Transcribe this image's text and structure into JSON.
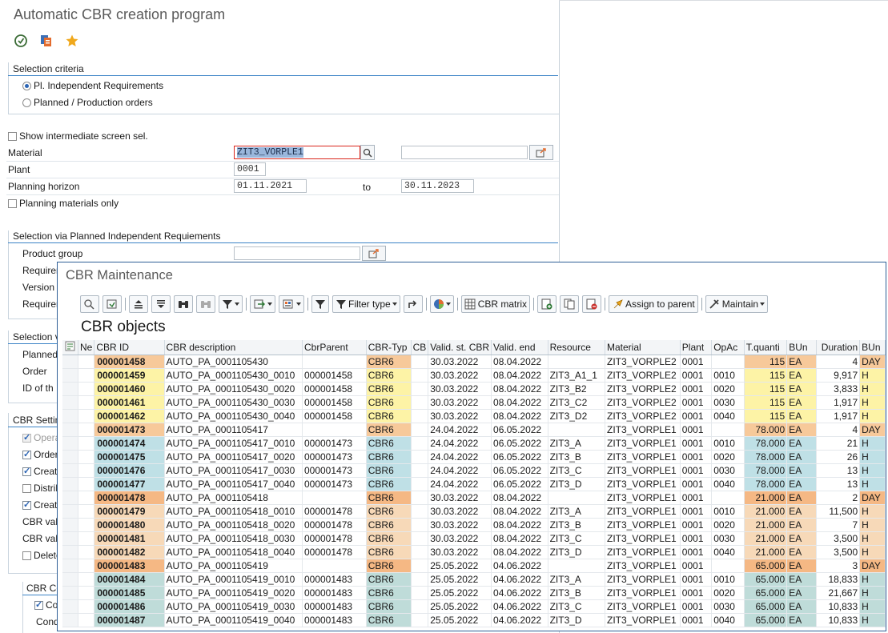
{
  "back": {
    "title": "Automatic CBR creation program",
    "sel_criteria": {
      "header": "Selection criteria",
      "opt1": "Pl. Independent Requirements",
      "opt2": "Planned / Production orders"
    },
    "show_inter": "Show intermediate screen sel.",
    "material": {
      "label": "Material",
      "value": "ZIT3_VORPLE1"
    },
    "plant": {
      "label": "Plant",
      "value": "0001"
    },
    "horizon": {
      "label": "Planning horizon",
      "from": "01.11.2021",
      "to_label": "to",
      "to": "30.11.2023"
    },
    "plan_only": "Planning materials only",
    "sel_pir": {
      "header": "Selection via Planned Independent Requiements",
      "product_group": "Product group",
      "labels": [
        "Requirem",
        "Version",
        "Requirem"
      ]
    },
    "sel_v": {
      "header": "Selection v",
      "labels": [
        "Planned",
        "Order",
        "ID of th"
      ]
    },
    "cbr_settings": {
      "header": "CBR Settin",
      "checks": [
        "Opera",
        "Order",
        "Creat",
        "Distrib",
        "Creat"
      ],
      "checks_on": [
        true,
        true,
        true,
        false,
        true
      ],
      "labels": [
        "CBR val",
        "CBR val"
      ],
      "delete": "Delete"
    },
    "cbr_co": {
      "header": "CBR Co",
      "check": "Co",
      "cond": "Cond"
    }
  },
  "front": {
    "title": "CBR Maintenance",
    "toolbar": {
      "filter_type": "Filter type",
      "cbr_matrix": "CBR matrix",
      "assign_parent": "Assign to parent",
      "maintain": "Maintain"
    },
    "section_title": "CBR objects",
    "columns": [
      "Ne",
      "CBR ID",
      "CBR description",
      "CbrParent",
      "CBR-Typ",
      "CB",
      "Valid. st. CBR",
      "Valid. end",
      "Resource",
      "Material",
      "Plant",
      "OpAc",
      "T.quanti",
      "BUn",
      "Duration",
      "BUn"
    ],
    "rows": [
      [
        "000001458",
        "AUTO_PA_0001105430",
        "",
        "CBR6",
        "30.03.2022",
        "08.04.2022",
        "",
        "ZIT3_VORPLE2",
        "0001",
        "",
        "115",
        "EA",
        "4",
        "DAY"
      ],
      [
        "000001459",
        "AUTO_PA_0001105430_0010",
        "000001458",
        "CBR6",
        "30.03.2022",
        "08.04.2022",
        "ZIT3_A1_1",
        "ZIT3_VORPLE2",
        "0001",
        "0010",
        "115",
        "EA",
        "9,917",
        "H"
      ],
      [
        "000001460",
        "AUTO_PA_0001105430_0020",
        "000001458",
        "CBR6",
        "30.03.2022",
        "08.04.2022",
        "ZIT3_B2",
        "ZIT3_VORPLE2",
        "0001",
        "0020",
        "115",
        "EA",
        "3,833",
        "H"
      ],
      [
        "000001461",
        "AUTO_PA_0001105430_0030",
        "000001458",
        "CBR6",
        "30.03.2022",
        "08.04.2022",
        "ZIT3_C2",
        "ZIT3_VORPLE2",
        "0001",
        "0030",
        "115",
        "EA",
        "1,917",
        "H"
      ],
      [
        "000001462",
        "AUTO_PA_0001105430_0040",
        "000001458",
        "CBR6",
        "30.03.2022",
        "08.04.2022",
        "ZIT3_D2",
        "ZIT3_VORPLE2",
        "0001",
        "0040",
        "115",
        "EA",
        "1,917",
        "H"
      ],
      [
        "000001473",
        "AUTO_PA_0001105417",
        "",
        "CBR6",
        "24.04.2022",
        "06.05.2022",
        "",
        "ZIT3_VORPLE1",
        "0001",
        "",
        "78.000",
        "EA",
        "4",
        "DAY"
      ],
      [
        "000001474",
        "AUTO_PA_0001105417_0010",
        "000001473",
        "CBR6",
        "24.04.2022",
        "06.05.2022",
        "ZIT3_A",
        "ZIT3_VORPLE1",
        "0001",
        "0010",
        "78.000",
        "EA",
        "21",
        "H"
      ],
      [
        "000001475",
        "AUTO_PA_0001105417_0020",
        "000001473",
        "CBR6",
        "24.04.2022",
        "06.05.2022",
        "ZIT3_B",
        "ZIT3_VORPLE1",
        "0001",
        "0020",
        "78.000",
        "EA",
        "26",
        "H"
      ],
      [
        "000001476",
        "AUTO_PA_0001105417_0030",
        "000001473",
        "CBR6",
        "24.04.2022",
        "06.05.2022",
        "ZIT3_C",
        "ZIT3_VORPLE1",
        "0001",
        "0030",
        "78.000",
        "EA",
        "13",
        "H"
      ],
      [
        "000001477",
        "AUTO_PA_0001105417_0040",
        "000001473",
        "CBR6",
        "24.04.2022",
        "06.05.2022",
        "ZIT3_D",
        "ZIT3_VORPLE1",
        "0001",
        "0040",
        "78.000",
        "EA",
        "13",
        "H"
      ],
      [
        "000001478",
        "AUTO_PA_0001105418",
        "",
        "CBR6",
        "30.03.2022",
        "08.04.2022",
        "",
        "ZIT3_VORPLE1",
        "0001",
        "",
        "21.000",
        "EA",
        "2",
        "DAY"
      ],
      [
        "000001479",
        "AUTO_PA_0001105418_0010",
        "000001478",
        "CBR6",
        "30.03.2022",
        "08.04.2022",
        "ZIT3_A",
        "ZIT3_VORPLE1",
        "0001",
        "0010",
        "21.000",
        "EA",
        "11,500",
        "H"
      ],
      [
        "000001480",
        "AUTO_PA_0001105418_0020",
        "000001478",
        "CBR6",
        "30.03.2022",
        "08.04.2022",
        "ZIT3_B",
        "ZIT3_VORPLE1",
        "0001",
        "0020",
        "21.000",
        "EA",
        "7",
        "H"
      ],
      [
        "000001481",
        "AUTO_PA_0001105418_0030",
        "000001478",
        "CBR6",
        "30.03.2022",
        "08.04.2022",
        "ZIT3_C",
        "ZIT3_VORPLE1",
        "0001",
        "0030",
        "21.000",
        "EA",
        "3,500",
        "H"
      ],
      [
        "000001482",
        "AUTO_PA_0001105418_0040",
        "000001478",
        "CBR6",
        "30.03.2022",
        "08.04.2022",
        "ZIT3_D",
        "ZIT3_VORPLE1",
        "0001",
        "0040",
        "21.000",
        "EA",
        "3,500",
        "H"
      ],
      [
        "000001483",
        "AUTO_PA_0001105419",
        "",
        "CBR6",
        "25.05.2022",
        "04.06.2022",
        "",
        "ZIT3_VORPLE1",
        "0001",
        "",
        "65.000",
        "EA",
        "3",
        "DAY"
      ],
      [
        "000001484",
        "AUTO_PA_0001105419_0010",
        "000001483",
        "CBR6",
        "25.05.2022",
        "04.06.2022",
        "ZIT3_A",
        "ZIT3_VORPLE1",
        "0001",
        "0010",
        "65.000",
        "EA",
        "18,833",
        "H"
      ],
      [
        "000001485",
        "AUTO_PA_0001105419_0020",
        "000001483",
        "CBR6",
        "25.05.2022",
        "04.06.2022",
        "ZIT3_B",
        "ZIT3_VORPLE1",
        "0001",
        "0020",
        "65.000",
        "EA",
        "21,667",
        "H"
      ],
      [
        "000001486",
        "AUTO_PA_0001105419_0030",
        "000001483",
        "CBR6",
        "25.05.2022",
        "04.06.2022",
        "ZIT3_C",
        "ZIT3_VORPLE1",
        "0001",
        "0030",
        "65.000",
        "EA",
        "10,833",
        "H"
      ],
      [
        "000001487",
        "AUTO_PA_0001105419_0040",
        "000001483",
        "CBR6",
        "25.05.2022",
        "04.06.2022",
        "ZIT3_D",
        "ZIT3_VORPLE1",
        "0001",
        "0040",
        "65.000",
        "EA",
        "10,833",
        "H"
      ]
    ],
    "row_groups": [
      "header",
      "child",
      "child",
      "child",
      "child",
      "header",
      "child",
      "child",
      "child",
      "child",
      "header",
      "child",
      "child",
      "child",
      "child",
      "header",
      "child",
      "child",
      "child",
      "child"
    ],
    "group_colors": [
      "#f7c99a",
      "#fdf3a6",
      "#f7c99a",
      "#bfe0e6",
      "#f5b884",
      "#f7d9b8",
      "#f5b884",
      "#bfdcd9"
    ]
  }
}
